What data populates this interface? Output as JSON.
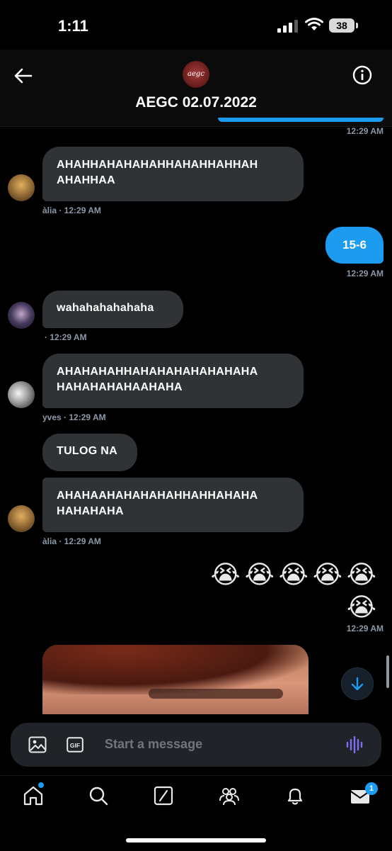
{
  "status_bar": {
    "time": "1:11",
    "battery": "38"
  },
  "header": {
    "avatar_text": "aegc",
    "title": "AEGC 02.07.2022"
  },
  "messages": {
    "top_time": "12:29 AM",
    "m1": {
      "text_line1": "AHAHHAHAHAHAHHAHAHHAHHAH",
      "text_line2": "AHAHHAA",
      "meta": "àlia · 12:29 AM"
    },
    "m2": {
      "text": "15-6",
      "time": "12:29 AM"
    },
    "m3": {
      "text": "wahahahahahaha",
      "meta": "· 12:29 AM"
    },
    "m4": {
      "text_line1": "AHAHAHAHHAHAHAHAHAHAHAHA",
      "text_line2": "HAHAHAHAHAAHAHA",
      "meta": "yves · 12:29 AM"
    },
    "m5": {
      "text": "TULOG NA"
    },
    "m6": {
      "text_line1": "AHAHAAHAHAHAHAHHAHHAHAHA",
      "text_line2": "HAHAHAHA",
      "meta": "àlia · 12:29 AM"
    },
    "m7": {
      "emoji_line1": "😭😭😭😭😭",
      "emoji_line2": "😭",
      "time": "12:29 AM"
    }
  },
  "composer": {
    "placeholder": "Start a message"
  },
  "bottom_nav": {
    "messages_badge": "1"
  },
  "colors": {
    "accent": "#1d9bf0",
    "bubble_incoming": "#2f3336",
    "background": "#000000",
    "muted_text": "#8b98a5"
  }
}
